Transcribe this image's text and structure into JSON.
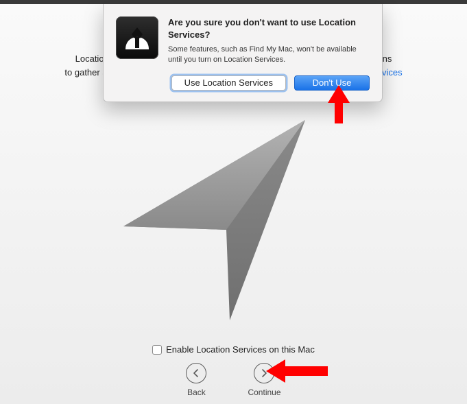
{
  "background": {
    "description_line1": "Location Services allows apps like Maps and services like Spotlight Suggestions",
    "description_line2": "to gather and use data indicating your approximate location.",
    "link_label": "About Location Services",
    "checkbox_label": "Enable Location Services on this Mac",
    "back_label": "Back",
    "continue_label": "Continue"
  },
  "dialog": {
    "title": "Are you sure you don't want to use Location Services?",
    "body": "Some features, such as Find My Mac, won't be available until you turn on Location Services.",
    "secondary_button": "Use Location Services",
    "primary_button": "Don't Use"
  }
}
